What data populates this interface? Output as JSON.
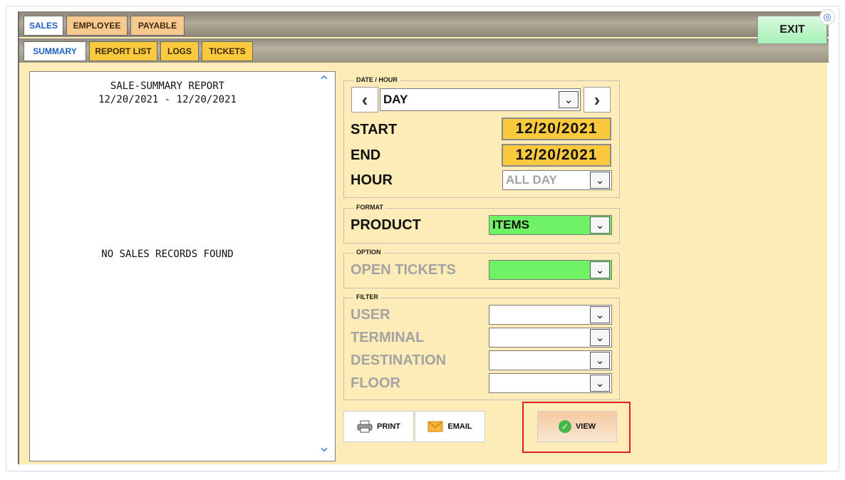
{
  "tabs_top": [
    {
      "label": "SALES"
    },
    {
      "label": "EMPLOYEE"
    },
    {
      "label": "PAYABLE"
    }
  ],
  "tabs_sub": [
    {
      "label": "SUMMARY"
    },
    {
      "label": "REPORT LIST"
    },
    {
      "label": "LOGS"
    },
    {
      "label": "TICKETS"
    }
  ],
  "exit_label": "EXIT",
  "report": {
    "title": "SALE-SUMMARY REPORT",
    "range": "12/20/2021 - 12/20/2021",
    "empty_message": "NO SALES RECORDS FOUND"
  },
  "date_hour": {
    "group_label": "DATE / HOUR",
    "period": "DAY",
    "start_label": "START",
    "start_value": "12/20/2021",
    "end_label": "END",
    "end_value": "12/20/2021",
    "hour_label": "HOUR",
    "hour_value": "ALL DAY"
  },
  "format": {
    "group_label": "FORMAT",
    "product_label": "PRODUCT",
    "product_value": "ITEMS"
  },
  "option": {
    "group_label": "OPTION",
    "open_tickets_label": "OPEN TICKETS",
    "open_tickets_value": ""
  },
  "filter": {
    "group_label": "FILTER",
    "user_label": "USER",
    "terminal_label": "TERMINAL",
    "destination_label": "DESTINATION",
    "floor_label": "FLOOR"
  },
  "actions": {
    "print_label": "PRINT",
    "email_label": "EMAIL",
    "view_label": "VIEW"
  },
  "colors": {
    "panel_bg": "#fdebb8",
    "date_highlight": "#fbc93d",
    "select_green": "#6ff265",
    "highlight_outline": "#e02020"
  }
}
